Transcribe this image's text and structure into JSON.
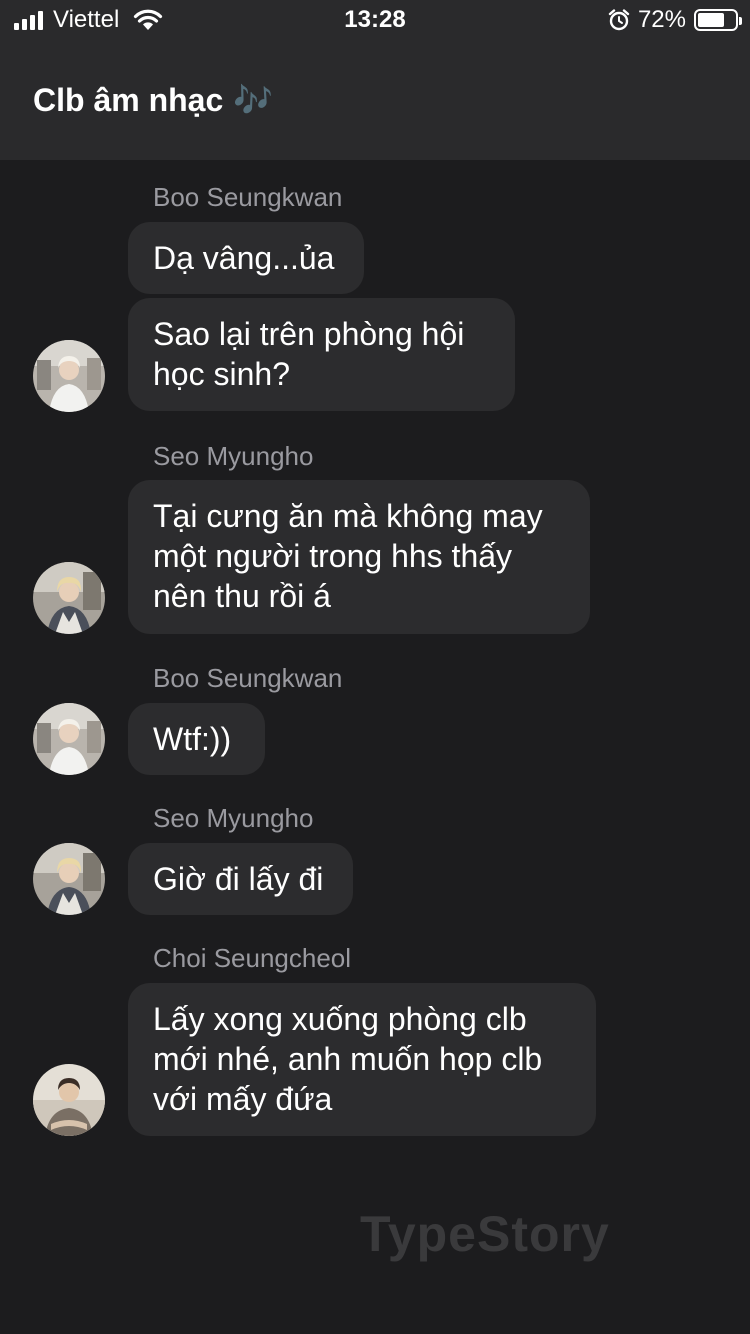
{
  "status_bar": {
    "carrier": "Viettel",
    "time": "13:28",
    "battery_percent": "72%",
    "battery_level": 0.72
  },
  "header": {
    "title": "Clb âm nhạc",
    "title_emoji": "🎶"
  },
  "messages": [
    {
      "sender": "Boo Seungkwan",
      "bubbles": [
        "Dạ vâng...ủa",
        "Sao lại trên phòng hội học sinh?"
      ]
    },
    {
      "sender": "Seo Myungho",
      "bubbles": [
        "Tại cưng ăn mà không may một người trong hhs thấy nên thu rồi á"
      ]
    },
    {
      "sender": "Boo Seungkwan",
      "bubbles": [
        "Wtf:))"
      ]
    },
    {
      "sender": "Seo Myungho",
      "bubbles": [
        "Giờ đi lấy đi"
      ]
    },
    {
      "sender": "Choi Seungcheol",
      "bubbles": [
        "Lấy xong xuống phòng clb mới nhé, anh muốn họp clb với mấy đứa"
      ]
    }
  ],
  "watermark": "TypeStory"
}
